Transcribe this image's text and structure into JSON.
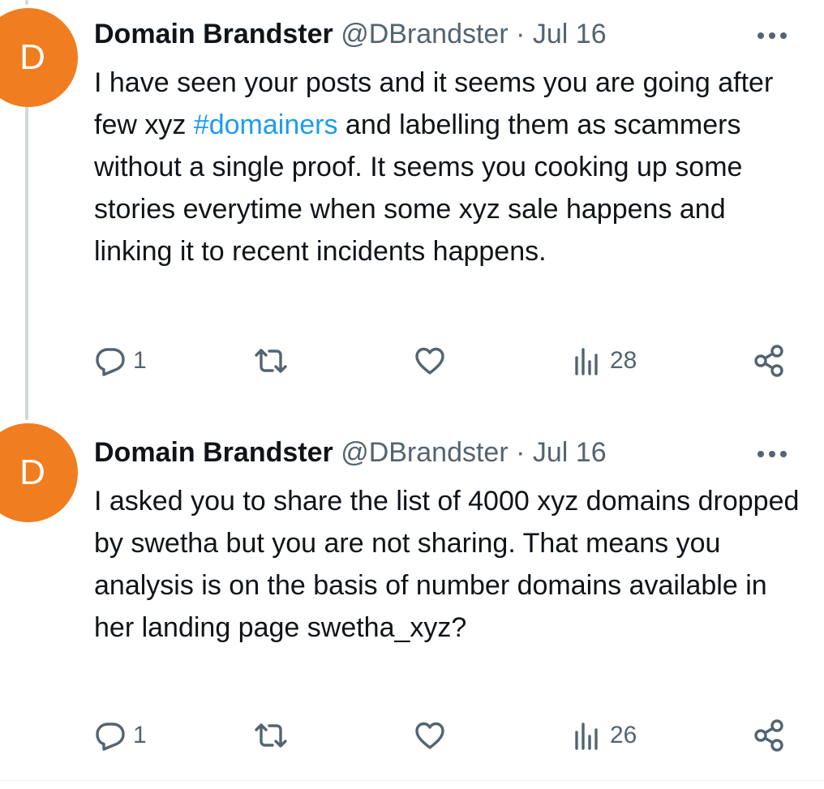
{
  "tweets": [
    {
      "avatar_letter": "D",
      "display_name": "Domain Brandster",
      "meta": "@DBrandster · Jul 16",
      "text_before": "I have seen your posts and it seems you are going after few xyz ",
      "hashtag": "#domainers",
      "text_after": " and labelling them as scammers without a single proof. It seems you cooking up some stories everytime when some xyz sale happens and linking it to recent incidents happens.",
      "reply_count": "1",
      "views_count": "28"
    },
    {
      "avatar_letter": "D",
      "display_name": "Domain Brandster",
      "meta": "@DBrandster · Jul 16",
      "text": "I asked you to share the list of 4000 xyz domains dropped by swetha but you are not sharing. That means you analysis is on the basis of number domains available in her landing page swetha_xyz?",
      "reply_count": "1",
      "views_count": "26"
    }
  ],
  "colors": {
    "avatar_bg": "#f07d1f",
    "hashtag": "#1d9bf0",
    "muted": "#536471",
    "thread_line": "#cfd9de"
  },
  "icons": [
    "reply-icon",
    "retweet-icon",
    "like-icon",
    "views-icon",
    "share-icon",
    "more-icon"
  ]
}
